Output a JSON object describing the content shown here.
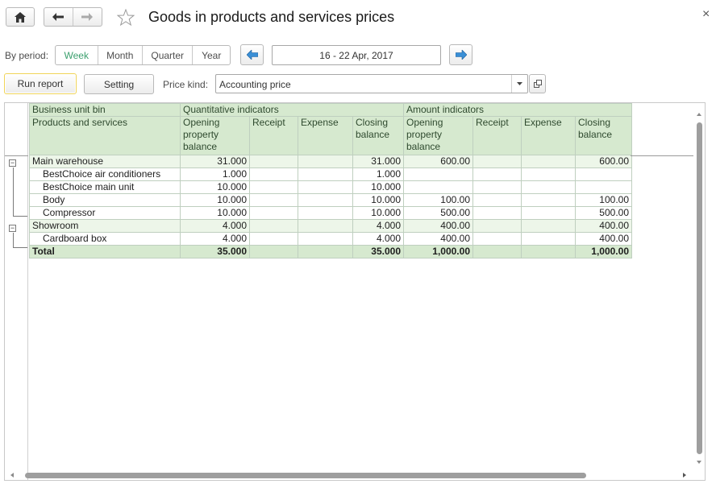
{
  "window": {
    "title": "Goods in products and services prices",
    "close_glyph": "×"
  },
  "toolbar": {
    "home_icon": "home-icon",
    "back_icon": "arrow-left-icon",
    "forward_icon": "arrow-right-icon",
    "favorite_icon": "star-icon"
  },
  "period": {
    "label": "By period:",
    "options": [
      "Week",
      "Month",
      "Quarter",
      "Year"
    ],
    "selected": "Week",
    "range": "16 - 22 Apr, 2017"
  },
  "actions": {
    "run_report": "Run report",
    "setting": "Setting",
    "price_kind_label": "Price kind:",
    "price_kind_value": "Accounting price"
  },
  "report": {
    "header": {
      "col1_top": "Business unit bin",
      "col1_bottom": "Products and services",
      "group_qty": "Quantitative indicators",
      "group_amt": "Amount indicators",
      "qty_opening": "Opening property balance",
      "qty_receipt": "Receipt",
      "qty_expense": "Expense",
      "qty_closing": "Closing balance",
      "amt_opening": "Opening property balance",
      "amt_receipt": "Receipt",
      "amt_expense": "Expense",
      "amt_closing": "Closing balance"
    },
    "rows": [
      {
        "name": "Main warehouse",
        "q_open": "31.000",
        "q_rec": "",
        "q_exp": "",
        "q_close": "31.000",
        "a_open": "600.00",
        "a_rec": "",
        "a_exp": "",
        "a_close": "600.00"
      },
      {
        "name": "BestChoice air conditioners",
        "q_open": "1.000",
        "q_rec": "",
        "q_exp": "",
        "q_close": "1.000",
        "a_open": "",
        "a_rec": "",
        "a_exp": "",
        "a_close": ""
      },
      {
        "name": "BestChoice main unit",
        "q_open": "10.000",
        "q_rec": "",
        "q_exp": "",
        "q_close": "10.000",
        "a_open": "",
        "a_rec": "",
        "a_exp": "",
        "a_close": ""
      },
      {
        "name": "Body",
        "q_open": "10.000",
        "q_rec": "",
        "q_exp": "",
        "q_close": "10.000",
        "a_open": "100.00",
        "a_rec": "",
        "a_exp": "",
        "a_close": "100.00"
      },
      {
        "name": "Compressor",
        "q_open": "10.000",
        "q_rec": "",
        "q_exp": "",
        "q_close": "10.000",
        "a_open": "500.00",
        "a_rec": "",
        "a_exp": "",
        "a_close": "500.00"
      },
      {
        "name": "Showroom",
        "q_open": "4.000",
        "q_rec": "",
        "q_exp": "",
        "q_close": "4.000",
        "a_open": "400.00",
        "a_rec": "",
        "a_exp": "",
        "a_close": "400.00"
      },
      {
        "name": "Cardboard box",
        "q_open": "4.000",
        "q_rec": "",
        "q_exp": "",
        "q_close": "4.000",
        "a_open": "400.00",
        "a_rec": "",
        "a_exp": "",
        "a_close": "400.00"
      },
      {
        "name": "Total",
        "q_open": "35.000",
        "q_rec": "",
        "q_exp": "",
        "q_close": "35.000",
        "a_open": "1,000.00",
        "a_rec": "",
        "a_exp": "",
        "a_close": "1,000.00"
      }
    ]
  }
}
